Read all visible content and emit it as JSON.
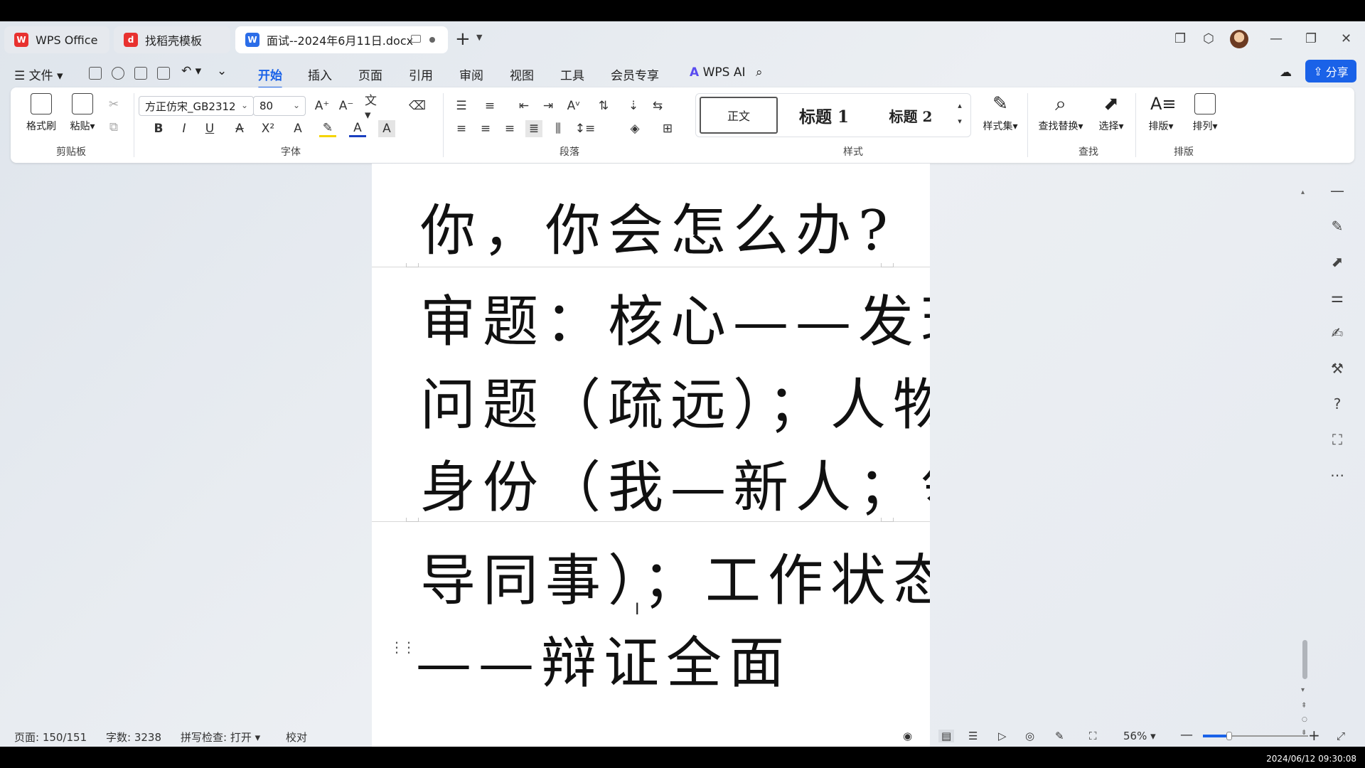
{
  "tabs": [
    {
      "label": "WPS Office",
      "icon": "wps-logo-icon",
      "color": "#e8312f"
    },
    {
      "label": "找稻壳模板",
      "icon": "docer-icon",
      "color": "#e8312f"
    },
    {
      "label": "面试--2024年6月11日.docx",
      "icon": "word-doc-icon",
      "color": "#2b6de8"
    }
  ],
  "menu": {
    "file": "文件",
    "items": [
      "开始",
      "插入",
      "页面",
      "引用",
      "审阅",
      "视图",
      "工具",
      "会员专享"
    ],
    "wps_ai": "WPS AI",
    "share": "分享"
  },
  "ribbon": {
    "clipboard": {
      "format_painter": "格式刷",
      "paste": "粘贴",
      "label": "剪贴板"
    },
    "font": {
      "name": "方正仿宋_GB2312",
      "size": "80",
      "label": "字体"
    },
    "paragraph": {
      "label": "段落"
    },
    "styles": {
      "items": [
        "正文",
        "标题 1",
        "标题 2"
      ],
      "style_set": "样式集",
      "label": "样式"
    },
    "find": {
      "find_replace": "查找替换",
      "select": "选择",
      "label": "查找"
    },
    "layout": {
      "arrange_text": "排版",
      "arrange": "排列",
      "label": "排版"
    }
  },
  "document": {
    "lines": [
      "你，你会怎么办?",
      "审题：核心——发现",
      "问题（疏远）；人物/",
      "身份（我—新人；领",
      "导同事）；工作状态",
      "——辩证全面"
    ]
  },
  "status": {
    "page": "页面: 150/151",
    "words": "字数: 3238",
    "spell": "拼写检查: 打开",
    "proof": "校对",
    "zoom": "56%",
    "zoom_fraction": 0.25
  },
  "clock": "2024/06/12 09:30:08",
  "accent": "#1a62e8"
}
